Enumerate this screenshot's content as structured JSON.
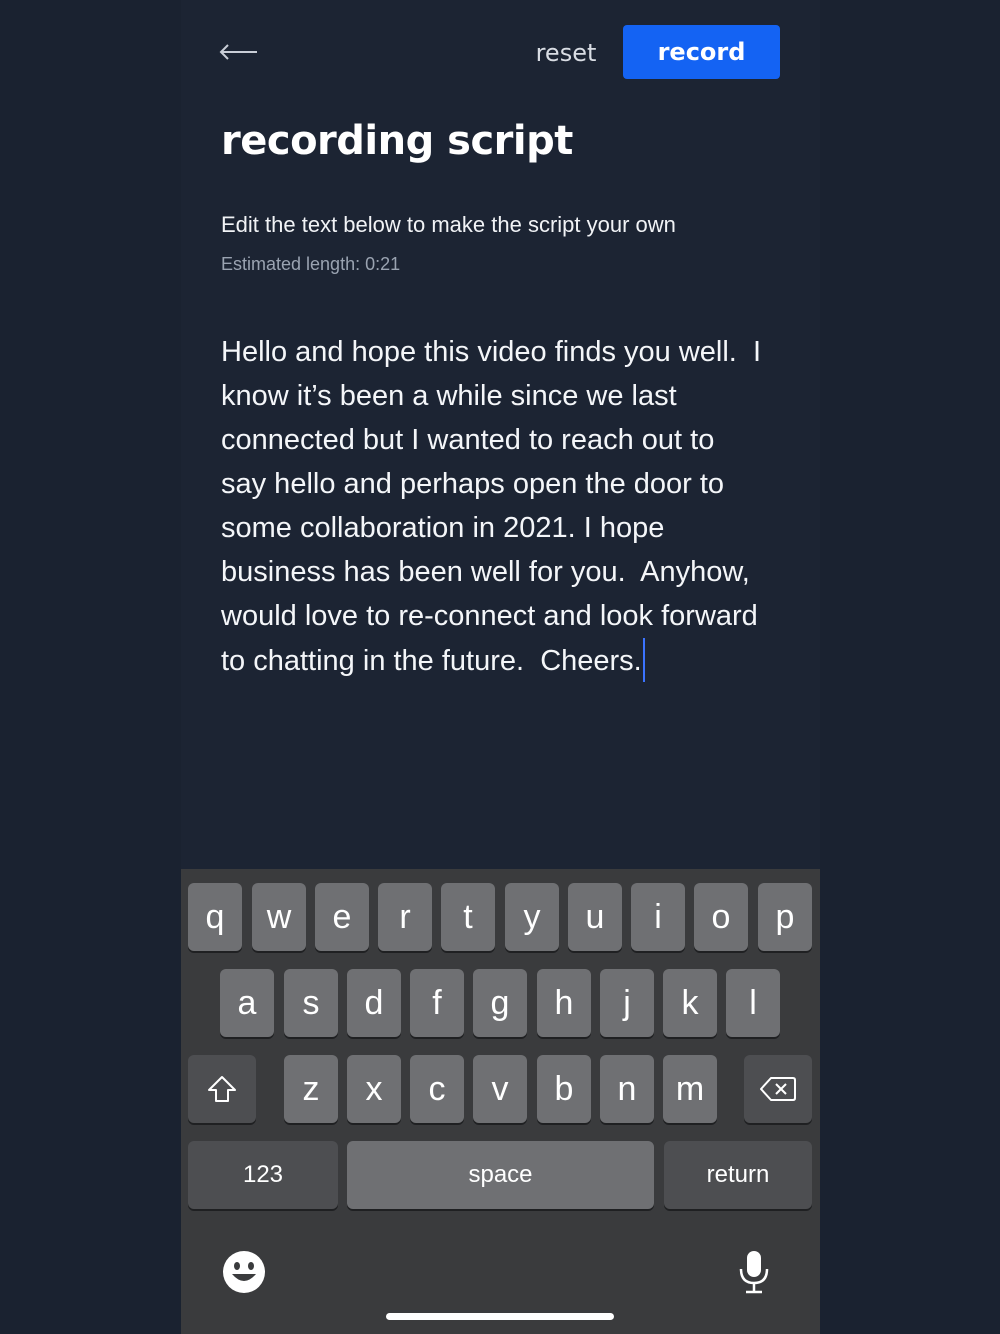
{
  "header": {
    "reset_label": "reset",
    "record_label": "record"
  },
  "main": {
    "title": "recording script",
    "subtitle": "Edit the text below to make the script your own",
    "estimate": "Estimated length: 0:21",
    "script_text": "Hello and hope this video finds you well.  I\nknow it’s been a while since we last\nconnected but I wanted to reach out to\nsay hello and perhaps open the door to\nsome collaboration in 2021. I hope\nbusiness has been well for you.  Anyhow,\nwould love to re-connect and look forward\nto chatting in the future.  Cheers."
  },
  "keyboard": {
    "row1": [
      "q",
      "w",
      "e",
      "r",
      "t",
      "y",
      "u",
      "i",
      "o",
      "p"
    ],
    "row2": [
      "a",
      "s",
      "d",
      "f",
      "g",
      "h",
      "j",
      "k",
      "l"
    ],
    "row3": [
      "z",
      "x",
      "c",
      "v",
      "b",
      "n",
      "m"
    ],
    "numbers_label": "123",
    "space_label": "space",
    "return_label": "return",
    "icons": [
      "shift-icon",
      "backspace-icon",
      "emoji-icon",
      "microphone-icon"
    ]
  },
  "colors": {
    "background": "#1c2433",
    "accent": "#1463f3",
    "caret": "#3b73ff",
    "keyboard": "#3a3b3d"
  }
}
